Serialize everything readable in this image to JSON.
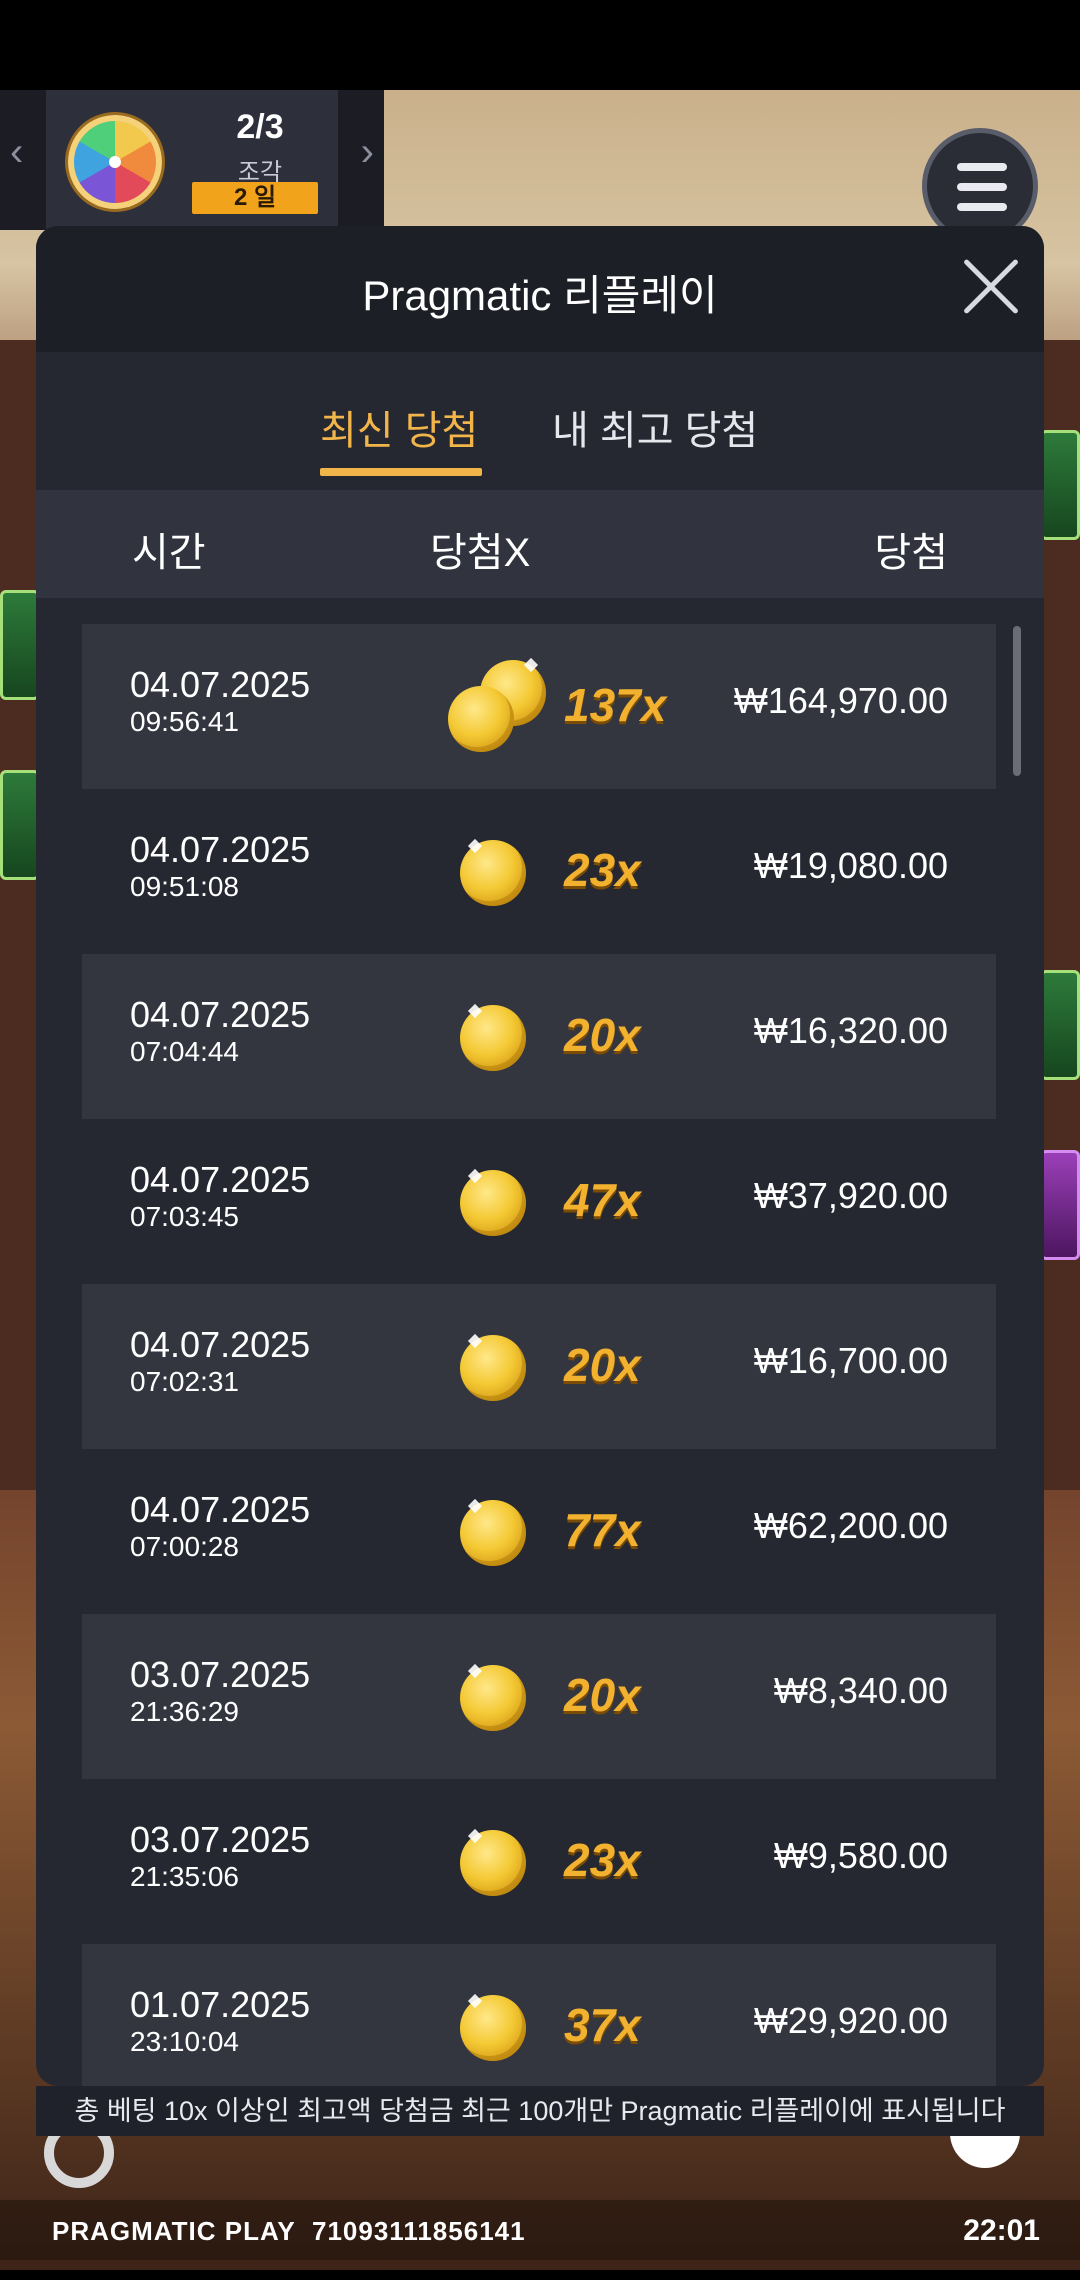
{
  "event": {
    "pieces": "2/3",
    "pieces_label": "조각",
    "days": "2 일"
  },
  "modal": {
    "title": "Pragmatic 리플레이",
    "tabs": [
      {
        "label": "최신 당첨",
        "active": true
      },
      {
        "label": "내 최고 당첨",
        "active": false
      }
    ],
    "columns": {
      "time": "시간",
      "multiplier": "당첨X",
      "win": "당첨"
    },
    "rows": [
      {
        "date": "04.07.2025",
        "time": "09:56:41",
        "multiplier": "137x",
        "amount": "₩164,970.00",
        "coins": 2
      },
      {
        "date": "04.07.2025",
        "time": "09:51:08",
        "multiplier": "23x",
        "amount": "₩19,080.00",
        "coins": 1
      },
      {
        "date": "04.07.2025",
        "time": "07:04:44",
        "multiplier": "20x",
        "amount": "₩16,320.00",
        "coins": 1
      },
      {
        "date": "04.07.2025",
        "time": "07:03:45",
        "multiplier": "47x",
        "amount": "₩37,920.00",
        "coins": 1
      },
      {
        "date": "04.07.2025",
        "time": "07:02:31",
        "multiplier": "20x",
        "amount": "₩16,700.00",
        "coins": 1
      },
      {
        "date": "04.07.2025",
        "time": "07:00:28",
        "multiplier": "77x",
        "amount": "₩62,200.00",
        "coins": 1
      },
      {
        "date": "03.07.2025",
        "time": "21:36:29",
        "multiplier": "20x",
        "amount": "₩8,340.00",
        "coins": 1
      },
      {
        "date": "03.07.2025",
        "time": "21:35:06",
        "multiplier": "23x",
        "amount": "₩9,580.00",
        "coins": 1
      },
      {
        "date": "01.07.2025",
        "time": "23:10:04",
        "multiplier": "37x",
        "amount": "₩29,920.00",
        "coins": 1
      }
    ],
    "footer_note": "총 베팅 10x 이상인 최고액 당첨금 최근 100개만 Pragmatic 리플레이에 표시됩니다"
  },
  "footer": {
    "provider": "PRAGMATIC PLAY",
    "round_id": "71093111856141",
    "clock": "22:01"
  },
  "colors": {
    "accent": "#f2b54a",
    "modal_bg": "#252731",
    "row_alt": "#33353f"
  },
  "icons": [
    "chevron-left-icon",
    "chevron-right-icon",
    "prize-wheel-icon",
    "hamburger-menu-icon",
    "close-icon",
    "coin-icon",
    "settings-icon",
    "info-icon"
  ]
}
